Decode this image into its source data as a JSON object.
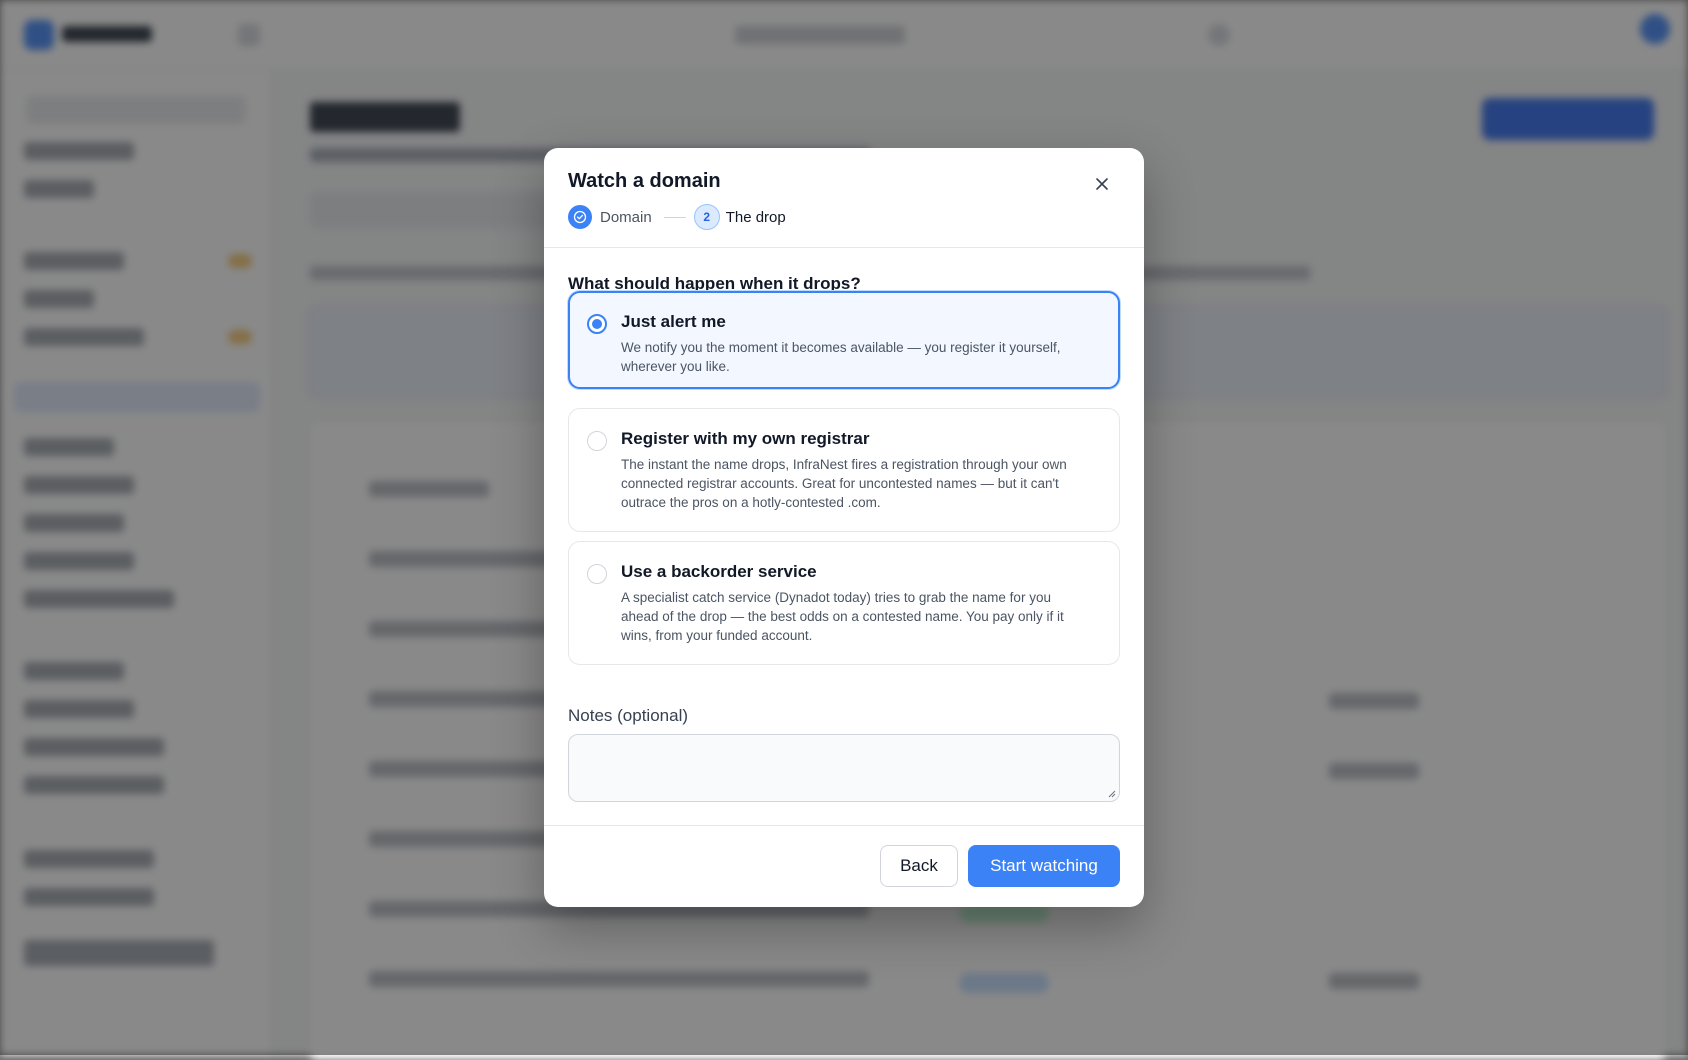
{
  "modal": {
    "title": "Watch a domain",
    "close_icon": "close-icon",
    "steps": [
      {
        "label": "Domain",
        "status": "complete",
        "icon": "check-circle-icon"
      },
      {
        "number": "2",
        "label": "The drop",
        "status": "current"
      }
    ],
    "question": "What should happen when it drops?",
    "options": [
      {
        "title": "Just alert me",
        "description": "We notify you the moment it becomes available — you register it yourself, wherever you like.",
        "selected": true
      },
      {
        "title": "Register with my own registrar",
        "description": "The instant the name drops, InfraNest fires a registration through your own connected registrar accounts. Great for uncontested names — but it can't outrace the pros on a hotly-contested .com.",
        "selected": false
      },
      {
        "title": "Use a backorder service",
        "description": "A specialist catch service (Dynadot today) tries to grab the name for you ahead of the drop — the best odds on a contested name. You pay only if it wins, from your funded account.",
        "selected": false
      }
    ],
    "notes": {
      "label": "Notes (optional)",
      "value": "",
      "placeholder": ""
    },
    "footer": {
      "back_label": "Back",
      "primary_label": "Start watching"
    }
  },
  "colors": {
    "accent": "#3b82f6",
    "overlay": "rgba(40,40,40,0.55)"
  }
}
